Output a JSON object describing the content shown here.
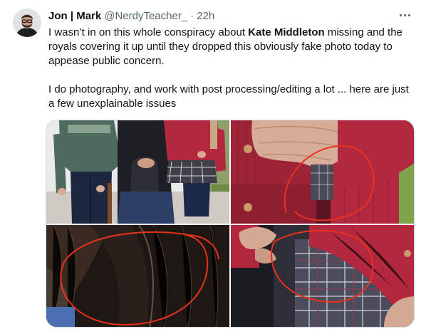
{
  "tweet": {
    "author_name": "Jon | Mark",
    "handle": "@NerdyTeacher_",
    "separator": "·",
    "time": "22h",
    "text_line1_before": "I wasn’t in on this whole conspiracy about ",
    "text_line1_bold": "Kate Middleton",
    "text_line1_after": " missing and the royals covering it up until they dropped this obviously fake photo today to appease public concern.",
    "text_line2": "I do photography, and work with post processing/editing a lot ... here are just a few unexplainable issues"
  },
  "icons": {
    "more": "more-horizontal-icon",
    "avatar": "avatar"
  },
  "colors": {
    "text": "#0f1419",
    "secondary": "#536471",
    "red_annotation": "#e8321e",
    "cardigan": "#b3283f"
  }
}
